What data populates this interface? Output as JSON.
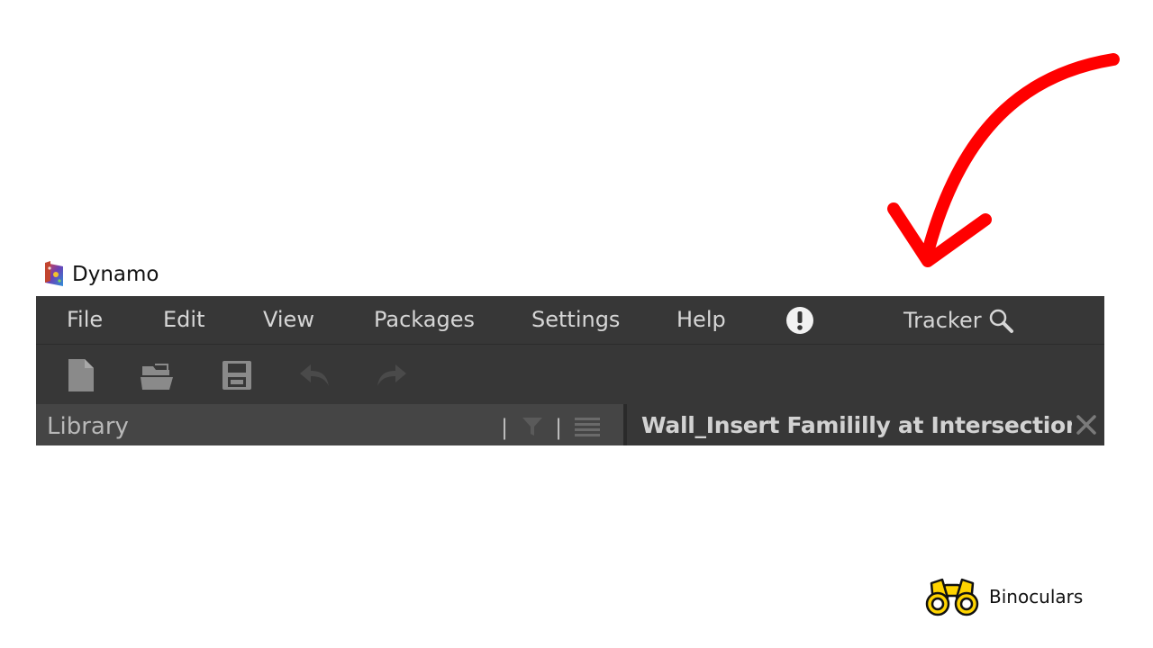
{
  "window": {
    "title": "Dynamo",
    "logo_icon": "dynamo-logo-icon"
  },
  "menu": {
    "items": [
      {
        "label": "File"
      },
      {
        "label": "Edit"
      },
      {
        "label": "View"
      },
      {
        "label": "Packages"
      },
      {
        "label": "Settings"
      },
      {
        "label": "Help"
      }
    ],
    "alert_icon": "exclamation-circle-icon",
    "tracker": {
      "label": "Tracker",
      "icon": "search-icon"
    }
  },
  "toolbar": {
    "buttons": [
      "new-file-icon",
      "open-folder-icon",
      "save-icon",
      "undo-icon",
      "redo-icon"
    ]
  },
  "library": {
    "title": "Library",
    "separator": "|",
    "filter_icon": "filter-icon",
    "list_icon": "list-view-icon"
  },
  "workspace": {
    "tab_title": "Wall_Insert Famililly at Intersection (Version",
    "close_icon": "close-icon"
  },
  "annotation": {
    "arrow_color": "#ff0000",
    "target": "Tracker"
  },
  "badge": {
    "icon": "binoculars-icon",
    "label": "Binoculars"
  },
  "colors": {
    "panel_bg": "#373737",
    "library_bg": "#454545",
    "menu_text": "#d6d6d6",
    "icon_gray": "#8a8a8a",
    "disabled_icon": "#4a4a4a",
    "accent_red": "#ff0000",
    "binocular_yellow": "#ffd400"
  }
}
